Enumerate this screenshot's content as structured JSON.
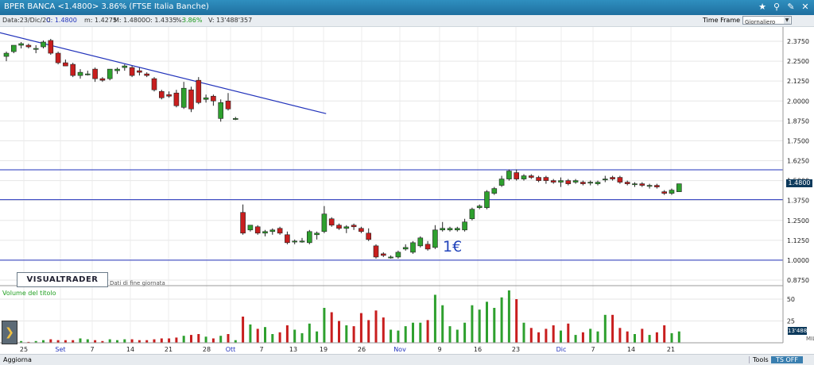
{
  "window": {
    "title": "BPER BANCA <1.4800> 3.86%  (FTSE Italia Banche)"
  },
  "info": {
    "date": "Data:23/Dic/20",
    "close": "C: 1.4800",
    "min": "m: 1.4275",
    "max": "M: 1.4800",
    "open": "O: 1.4335",
    "pct_label": "%:",
    "pct_value": "3.86%",
    "volume": "V: 13'488'357"
  },
  "timeframe": {
    "label": "Time Frame",
    "value": "Giornaliero"
  },
  "logo": {
    "text": "VISUALTRADER",
    "sub": "Dati di fine giornata"
  },
  "volume_panel": {
    "title": "Volume del titolo",
    "current": "13'488",
    "unit": "MIL"
  },
  "annotation": {
    "text": "1€"
  },
  "price_tag": "1.4800",
  "bottom": {
    "update": "Aggiorna",
    "tools": "Tools",
    "tsoff": "TS OFF"
  },
  "colors": {
    "up": "#2ea02e",
    "down": "#c81e1e",
    "lines": "#2233bb",
    "grid": "#e6e6e6"
  },
  "chart_data": {
    "type": "candlestick",
    "y_axis": {
      "min": 0.875,
      "max": 2.375,
      "ticks": [
        "0.8750",
        "1.0000",
        "1.1250",
        "1.2500",
        "1.3750",
        "1.5000",
        "1.6250",
        "1.7500",
        "1.8750",
        "2.0000",
        "2.1250",
        "2.2500",
        "2.3750"
      ]
    },
    "volume_axis": {
      "ticks": [
        "25",
        "50"
      ]
    },
    "x_labels": [
      "25",
      "Set",
      "7",
      "14",
      "21",
      "28",
      "Ott",
      "7",
      "13",
      "19",
      "26",
      "Nov",
      "9",
      "16",
      "23",
      "Dic",
      "7",
      "14",
      "21"
    ],
    "trendline": {
      "from": {
        "i": -1,
        "price": 2.43
      },
      "to": {
        "i": 32.5,
        "price": 2.05
      }
    },
    "horizontal_lines": [
      1.0,
      1.38,
      1.568
    ],
    "candles": [
      {
        "i": 0,
        "o": 2.28,
        "h": 2.31,
        "l": 2.25,
        "c": 2.3,
        "v": 3
      },
      {
        "i": 1,
        "o": 2.31,
        "h": 2.35,
        "l": 2.3,
        "c": 2.35,
        "v": 2
      },
      {
        "i": 2,
        "o": 2.35,
        "h": 2.37,
        "l": 2.33,
        "c": 2.36,
        "v": 2
      },
      {
        "i": 3,
        "o": 2.35,
        "h": 2.36,
        "l": 2.33,
        "c": 2.34,
        "v": 1
      },
      {
        "i": 4,
        "o": 2.33,
        "h": 2.35,
        "l": 2.3,
        "c": 2.33,
        "v": 2
      },
      {
        "i": 5,
        "o": 2.34,
        "h": 2.38,
        "l": 2.33,
        "c": 2.37,
        "v": 3
      },
      {
        "i": 6,
        "o": 2.38,
        "h": 2.39,
        "l": 2.29,
        "c": 2.3,
        "v": 4
      },
      {
        "i": 7,
        "o": 2.3,
        "h": 2.31,
        "l": 2.23,
        "c": 2.24,
        "v": 3
      },
      {
        "i": 8,
        "o": 2.24,
        "h": 2.26,
        "l": 2.22,
        "c": 2.22,
        "v": 3
      },
      {
        "i": 9,
        "o": 2.23,
        "h": 2.24,
        "l": 2.15,
        "c": 2.16,
        "v": 3
      },
      {
        "i": 10,
        "o": 2.16,
        "h": 2.2,
        "l": 2.14,
        "c": 2.18,
        "v": 5
      },
      {
        "i": 11,
        "o": 2.17,
        "h": 2.19,
        "l": 2.16,
        "c": 2.17,
        "v": 4
      },
      {
        "i": 12,
        "o": 2.2,
        "h": 2.21,
        "l": 2.12,
        "c": 2.14,
        "v": 3
      },
      {
        "i": 13,
        "o": 2.14,
        "h": 2.15,
        "l": 2.12,
        "c": 2.13,
        "v": 2
      },
      {
        "i": 14,
        "o": 2.14,
        "h": 2.2,
        "l": 2.13,
        "c": 2.2,
        "v": 4
      },
      {
        "i": 15,
        "o": 2.19,
        "h": 2.21,
        "l": 2.17,
        "c": 2.2,
        "v": 3
      },
      {
        "i": 16,
        "o": 2.21,
        "h": 2.23,
        "l": 2.19,
        "c": 2.22,
        "v": 4
      },
      {
        "i": 17,
        "o": 2.21,
        "h": 2.22,
        "l": 2.15,
        "c": 2.16,
        "v": 4
      },
      {
        "i": 18,
        "o": 2.19,
        "h": 2.21,
        "l": 2.16,
        "c": 2.18,
        "v": 3
      },
      {
        "i": 19,
        "o": 2.17,
        "h": 2.18,
        "l": 2.15,
        "c": 2.16,
        "v": 3
      },
      {
        "i": 20,
        "o": 2.14,
        "h": 2.15,
        "l": 2.06,
        "c": 2.07,
        "v": 4
      },
      {
        "i": 21,
        "o": 2.06,
        "h": 2.07,
        "l": 2.01,
        "c": 2.02,
        "v": 5
      },
      {
        "i": 22,
        "o": 2.04,
        "h": 2.06,
        "l": 2.02,
        "c": 2.03,
        "v": 5
      },
      {
        "i": 23,
        "o": 2.05,
        "h": 2.07,
        "l": 1.96,
        "c": 1.97,
        "v": 6
      },
      {
        "i": 24,
        "o": 1.96,
        "h": 2.12,
        "l": 1.95,
        "c": 2.08,
        "v": 8
      },
      {
        "i": 25,
        "o": 2.07,
        "h": 2.09,
        "l": 1.93,
        "c": 1.95,
        "v": 9
      },
      {
        "i": 26,
        "o": 2.13,
        "h": 2.15,
        "l": 1.98,
        "c": 1.99,
        "v": 10
      },
      {
        "i": 27,
        "o": 2.01,
        "h": 2.04,
        "l": 1.99,
        "c": 2.02,
        "v": 7
      },
      {
        "i": 28,
        "o": 2.03,
        "h": 2.04,
        "l": 1.97,
        "c": 2.0,
        "v": 5
      },
      {
        "i": 29,
        "o": 1.89,
        "h": 2.01,
        "l": 1.87,
        "c": 1.99,
        "v": 8
      },
      {
        "i": 30,
        "o": 2.0,
        "h": 2.05,
        "l": 1.94,
        "c": 1.95,
        "v": 10
      },
      {
        "i": 31,
        "o": 1.89,
        "h": 1.9,
        "l": 1.88,
        "c": 1.89,
        "v": 3
      },
      {
        "i": 32,
        "o": 1.3,
        "h": 1.35,
        "l": 1.16,
        "c": 1.17,
        "v": 30
      },
      {
        "i": 33,
        "o": 1.19,
        "h": 1.22,
        "l": 1.18,
        "c": 1.22,
        "v": 21
      },
      {
        "i": 34,
        "o": 1.21,
        "h": 1.22,
        "l": 1.16,
        "c": 1.17,
        "v": 16
      },
      {
        "i": 35,
        "o": 1.17,
        "h": 1.19,
        "l": 1.15,
        "c": 1.18,
        "v": 18
      },
      {
        "i": 36,
        "o": 1.18,
        "h": 1.2,
        "l": 1.16,
        "c": 1.19,
        "v": 10
      },
      {
        "i": 37,
        "o": 1.2,
        "h": 1.21,
        "l": 1.16,
        "c": 1.17,
        "v": 12
      },
      {
        "i": 38,
        "o": 1.16,
        "h": 1.18,
        "l": 1.1,
        "c": 1.11,
        "v": 20
      },
      {
        "i": 39,
        "o": 1.12,
        "h": 1.13,
        "l": 1.1,
        "c": 1.12,
        "v": 15
      },
      {
        "i": 40,
        "o": 1.12,
        "h": 1.14,
        "l": 1.11,
        "c": 1.12,
        "v": 11
      },
      {
        "i": 41,
        "o": 1.11,
        "h": 1.19,
        "l": 1.1,
        "c": 1.18,
        "v": 22
      },
      {
        "i": 42,
        "o": 1.16,
        "h": 1.18,
        "l": 1.13,
        "c": 1.17,
        "v": 13
      },
      {
        "i": 43,
        "o": 1.18,
        "h": 1.34,
        "l": 1.17,
        "c": 1.29,
        "v": 40
      },
      {
        "i": 44,
        "o": 1.26,
        "h": 1.27,
        "l": 1.21,
        "c": 1.22,
        "v": 35
      },
      {
        "i": 45,
        "o": 1.22,
        "h": 1.23,
        "l": 1.19,
        "c": 1.2,
        "v": 25
      },
      {
        "i": 46,
        "o": 1.2,
        "h": 1.22,
        "l": 1.17,
        "c": 1.21,
        "v": 20
      },
      {
        "i": 47,
        "o": 1.22,
        "h": 1.23,
        "l": 1.19,
        "c": 1.21,
        "v": 19
      },
      {
        "i": 48,
        "o": 1.2,
        "h": 1.21,
        "l": 1.17,
        "c": 1.18,
        "v": 34
      },
      {
        "i": 49,
        "o": 1.17,
        "h": 1.2,
        "l": 1.12,
        "c": 1.13,
        "v": 26
      },
      {
        "i": 50,
        "o": 1.09,
        "h": 1.1,
        "l": 1.01,
        "c": 1.02,
        "v": 37
      },
      {
        "i": 51,
        "o": 1.04,
        "h": 1.05,
        "l": 1.02,
        "c": 1.03,
        "v": 29
      },
      {
        "i": 52,
        "o": 1.02,
        "h": 1.03,
        "l": 1.01,
        "c": 1.02,
        "v": 15
      },
      {
        "i": 53,
        "o": 1.02,
        "h": 1.06,
        "l": 1.01,
        "c": 1.05,
        "v": 14
      },
      {
        "i": 54,
        "o": 1.07,
        "h": 1.1,
        "l": 1.06,
        "c": 1.08,
        "v": 19
      },
      {
        "i": 55,
        "o": 1.05,
        "h": 1.12,
        "l": 1.04,
        "c": 1.11,
        "v": 23
      },
      {
        "i": 56,
        "o": 1.09,
        "h": 1.15,
        "l": 1.08,
        "c": 1.14,
        "v": 23
      },
      {
        "i": 57,
        "o": 1.1,
        "h": 1.12,
        "l": 1.06,
        "c": 1.07,
        "v": 26
      },
      {
        "i": 58,
        "o": 1.08,
        "h": 1.22,
        "l": 1.07,
        "c": 1.19,
        "v": 55
      },
      {
        "i": 59,
        "o": 1.19,
        "h": 1.24,
        "l": 1.18,
        "c": 1.2,
        "v": 43
      },
      {
        "i": 60,
        "o": 1.19,
        "h": 1.21,
        "l": 1.18,
        "c": 1.2,
        "v": 19
      },
      {
        "i": 61,
        "o": 1.19,
        "h": 1.21,
        "l": 1.18,
        "c": 1.2,
        "v": 15
      },
      {
        "i": 62,
        "o": 1.19,
        "h": 1.26,
        "l": 1.18,
        "c": 1.24,
        "v": 23
      },
      {
        "i": 63,
        "o": 1.26,
        "h": 1.33,
        "l": 1.25,
        "c": 1.32,
        "v": 43
      },
      {
        "i": 64,
        "o": 1.33,
        "h": 1.35,
        "l": 1.32,
        "c": 1.34,
        "v": 38
      },
      {
        "i": 65,
        "o": 1.33,
        "h": 1.44,
        "l": 1.32,
        "c": 1.43,
        "v": 47
      },
      {
        "i": 66,
        "o": 1.42,
        "h": 1.46,
        "l": 1.41,
        "c": 1.45,
        "v": 40
      },
      {
        "i": 67,
        "o": 1.47,
        "h": 1.53,
        "l": 1.46,
        "c": 1.51,
        "v": 52
      },
      {
        "i": 68,
        "o": 1.51,
        "h": 1.57,
        "l": 1.5,
        "c": 1.56,
        "v": 60
      },
      {
        "i": 69,
        "o": 1.55,
        "h": 1.57,
        "l": 1.5,
        "c": 1.51,
        "v": 50
      },
      {
        "i": 70,
        "o": 1.51,
        "h": 1.54,
        "l": 1.5,
        "c": 1.53,
        "v": 23
      },
      {
        "i": 71,
        "o": 1.53,
        "h": 1.54,
        "l": 1.51,
        "c": 1.52,
        "v": 17
      },
      {
        "i": 72,
        "o": 1.52,
        "h": 1.53,
        "l": 1.49,
        "c": 1.5,
        "v": 12
      },
      {
        "i": 73,
        "o": 1.52,
        "h": 1.53,
        "l": 1.48,
        "c": 1.5,
        "v": 16
      },
      {
        "i": 74,
        "o": 1.5,
        "h": 1.51,
        "l": 1.48,
        "c": 1.49,
        "v": 20
      },
      {
        "i": 75,
        "o": 1.49,
        "h": 1.52,
        "l": 1.46,
        "c": 1.5,
        "v": 14
      },
      {
        "i": 76,
        "o": 1.5,
        "h": 1.51,
        "l": 1.47,
        "c": 1.48,
        "v": 22
      },
      {
        "i": 77,
        "o": 1.49,
        "h": 1.51,
        "l": 1.48,
        "c": 1.5,
        "v": 9
      },
      {
        "i": 78,
        "o": 1.49,
        "h": 1.5,
        "l": 1.47,
        "c": 1.48,
        "v": 12
      },
      {
        "i": 79,
        "o": 1.49,
        "h": 1.5,
        "l": 1.47,
        "c": 1.49,
        "v": 16
      },
      {
        "i": 80,
        "o": 1.48,
        "h": 1.5,
        "l": 1.47,
        "c": 1.49,
        "v": 13
      },
      {
        "i": 81,
        "o": 1.51,
        "h": 1.53,
        "l": 1.49,
        "c": 1.51,
        "v": 32
      },
      {
        "i": 82,
        "o": 1.52,
        "h": 1.53,
        "l": 1.5,
        "c": 1.51,
        "v": 32
      },
      {
        "i": 83,
        "o": 1.52,
        "h": 1.53,
        "l": 1.48,
        "c": 1.49,
        "v": 17
      },
      {
        "i": 84,
        "o": 1.49,
        "h": 1.5,
        "l": 1.47,
        "c": 1.48,
        "v": 13
      },
      {
        "i": 85,
        "o": 1.48,
        "h": 1.49,
        "l": 1.46,
        "c": 1.48,
        "v": 10
      },
      {
        "i": 86,
        "o": 1.48,
        "h": 1.49,
        "l": 1.46,
        "c": 1.47,
        "v": 16
      },
      {
        "i": 87,
        "o": 1.47,
        "h": 1.48,
        "l": 1.45,
        "c": 1.47,
        "v": 9
      },
      {
        "i": 88,
        "o": 1.47,
        "h": 1.48,
        "l": 1.45,
        "c": 1.46,
        "v": 12
      },
      {
        "i": 89,
        "o": 1.43,
        "h": 1.44,
        "l": 1.41,
        "c": 1.42,
        "v": 20
      },
      {
        "i": 90,
        "o": 1.42,
        "h": 1.45,
        "l": 1.41,
        "c": 1.44,
        "v": 11
      },
      {
        "i": 91,
        "o": 1.43,
        "h": 1.48,
        "l": 1.43,
        "c": 1.48,
        "v": 13
      }
    ]
  }
}
